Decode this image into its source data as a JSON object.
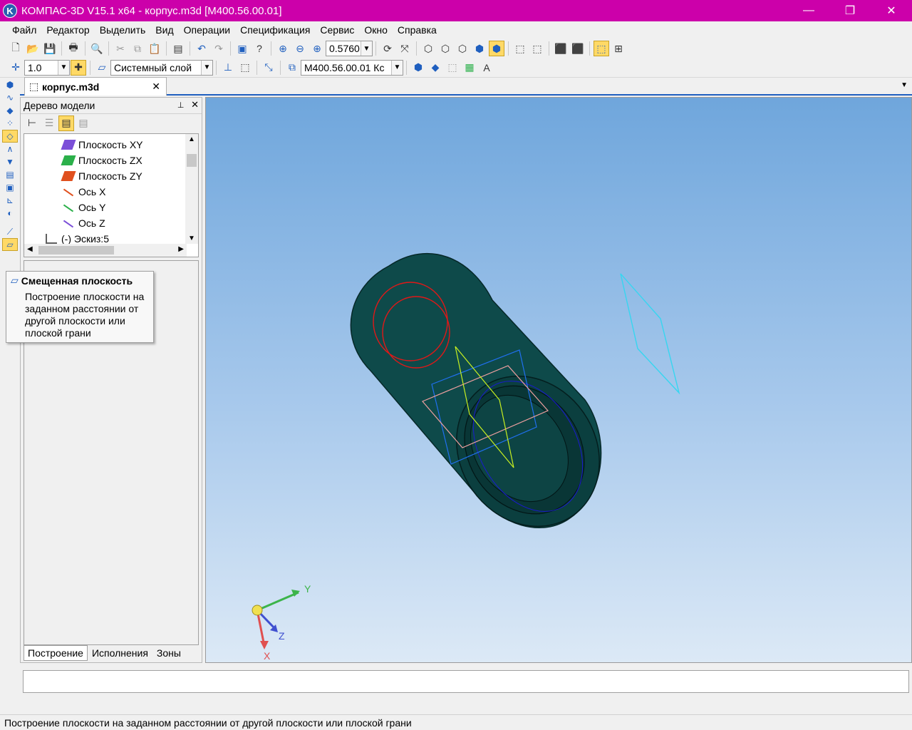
{
  "window": {
    "title": "КОМПАС-3D V15.1 x64 - корпус.m3d [M400.56.00.01]",
    "logo_letter": "K",
    "min": "—",
    "max": "❐",
    "close": "✕"
  },
  "menu": [
    "Файл",
    "Редактор",
    "Выделить",
    "Вид",
    "Операции",
    "Спецификация",
    "Сервис",
    "Окно",
    "Справка"
  ],
  "toolbar": {
    "zoom_value": "0.5760",
    "step_value": "1.0",
    "layer_value": "Системный слой",
    "designation_value": "M400.56.00.01 Кс"
  },
  "document_tab": {
    "label": "корпус.m3d",
    "close": "✕"
  },
  "tree_panel": {
    "title": "Дерево модели",
    "pin": "📌",
    "close": "✕",
    "items": [
      {
        "label": "Плоскость XY",
        "color": "#7b4fd8"
      },
      {
        "label": "Плоскость ZX",
        "color": "#2bb04a"
      },
      {
        "label": "Плоскость ZY",
        "color": "#e0501e"
      },
      {
        "label": "Ось X",
        "color": "#e0501e"
      },
      {
        "label": "Ось Y",
        "color": "#2bb04a"
      },
      {
        "label": "Ось Z",
        "color": "#7b4fd8"
      },
      {
        "label": "(-) Эскиз:5",
        "color": "#606060"
      }
    ],
    "tabs": [
      "Построение",
      "Исполнения",
      "Зоны"
    ]
  },
  "tooltip": {
    "title": "Смещенная плоскость",
    "body": "Построение плоскости на заданном расстоянии от другой плоскости или плоской грани"
  },
  "viewport": {
    "axis_labels": {
      "x": "X",
      "y": "Y",
      "z": "Z"
    },
    "colors": {
      "body": "#0e4a4a",
      "sketch_red": "#e01818",
      "plane_cyan": "#36d6f0",
      "plane_yellow": "#c8f020",
      "plane_pink": "#f0a0a0",
      "plane_blue": "#2070f0"
    }
  },
  "status": {
    "text": "Построение плоскости на заданном расстоянии от другой плоскости или плоской грани"
  }
}
